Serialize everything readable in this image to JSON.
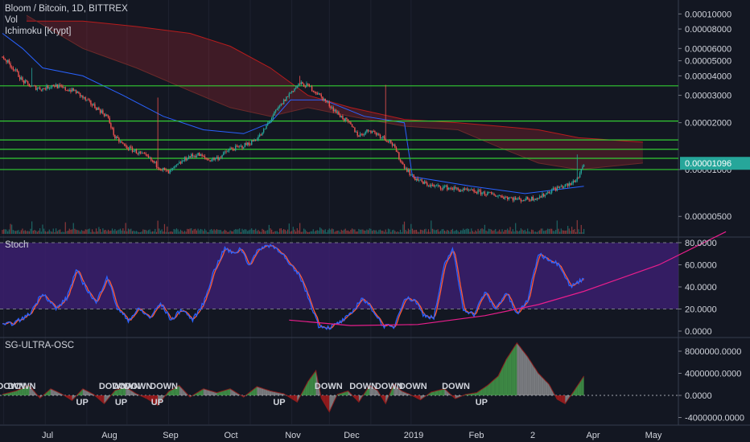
{
  "header": {
    "symbol_line": "Bloom / Bitcoin, 1D, BITTREX",
    "indicator_vol": "Vol",
    "indicator_ichimoku": "Ichimoku [Krypt]"
  },
  "price_badge": "0.00001096",
  "panes": {
    "stoch_label": "Stoch",
    "osc_label": "SG-ULTRA-OSC"
  },
  "colors": {
    "background": "#131722",
    "bull": "#26a69a",
    "bear": "#ef5350",
    "hline": "#33cc33",
    "stoch_fill": "#3b1f6e",
    "stoch_k": "#2962ff",
    "stoch_d": "#ff5a36",
    "curve": "#e91e8c",
    "badge": "#26a69a"
  },
  "chart_data": [
    {
      "type": "candlestick",
      "title": "Bloom / Bitcoin, 1D, BITTREX",
      "x_tick_labels": [
        "Jul",
        "Aug",
        "Sep",
        "Oct",
        "Nov",
        "Dec",
        "2019",
        "Feb",
        "2",
        "Apr",
        "May"
      ],
      "y_tick_labels": [
        "0.00010000",
        "0.00008000",
        "0.00006000",
        "0.00005000",
        "0.00004000",
        "0.00003000",
        "0.00002000",
        "0.00001000",
        "0.00000500"
      ],
      "y_scale": "log",
      "last_price": 1.096e-05,
      "close_trend": [
        [
          0,
          5.3e-05
        ],
        [
          8,
          4.5e-05
        ],
        [
          15,
          3.7e-05
        ],
        [
          22,
          3.4e-05
        ],
        [
          30,
          3.3e-05
        ],
        [
          38,
          3.5e-05
        ],
        [
          46,
          3.3e-05
        ],
        [
          54,
          3.2e-05
        ],
        [
          62,
          2.8e-05
        ],
        [
          70,
          2.5e-05
        ],
        [
          78,
          2.2e-05
        ],
        [
          84,
          1.6e-05
        ],
        [
          92,
          1.4e-05
        ],
        [
          100,
          1.3e-05
        ],
        [
          108,
          1.2e-05
        ],
        [
          116,
          1.05e-05
        ],
        [
          124,
          9.5e-06
        ],
        [
          130,
          1.05e-05
        ],
        [
          138,
          1.2e-05
        ],
        [
          146,
          1.25e-05
        ],
        [
          154,
          1.15e-05
        ],
        [
          162,
          1.2e-05
        ],
        [
          170,
          1.35e-05
        ],
        [
          178,
          1.4e-05
        ],
        [
          186,
          1.5e-05
        ],
        [
          194,
          1.7e-05
        ],
        [
          200,
          2.1e-05
        ],
        [
          208,
          2.6e-05
        ],
        [
          216,
          3.2e-05
        ],
        [
          222,
          3.55e-05
        ],
        [
          228,
          3.45e-05
        ],
        [
          234,
          3.15e-05
        ],
        [
          242,
          2.7e-05
        ],
        [
          250,
          2.3e-05
        ],
        [
          258,
          2e-05
        ],
        [
          266,
          1.65e-05
        ],
        [
          274,
          1.8e-05
        ],
        [
          282,
          1.65e-05
        ],
        [
          290,
          1.5e-05
        ],
        [
          298,
          1.1e-05
        ],
        [
          306,
          9e-06
        ],
        [
          314,
          8.2e-06
        ],
        [
          322,
          7.8e-06
        ],
        [
          330,
          7.7e-06
        ],
        [
          338,
          7.5e-06
        ],
        [
          346,
          7.3e-06
        ],
        [
          354,
          7.2e-06
        ],
        [
          362,
          7e-06
        ],
        [
          370,
          6.8e-06
        ],
        [
          378,
          6.6e-06
        ],
        [
          386,
          6.4e-06
        ],
        [
          394,
          6.5e-06
        ],
        [
          402,
          6.7e-06
        ],
        [
          410,
          7.4e-06
        ],
        [
          418,
          7.8e-06
        ],
        [
          424,
          8e-06
        ],
        [
          430,
          9e-06
        ],
        [
          434,
          1.096e-05
        ]
      ],
      "spikes": [
        {
          "x": 22,
          "high": 4.5e-05
        },
        {
          "x": 116,
          "high": 2.9e-05
        },
        {
          "x": 222,
          "high": 4e-05
        },
        {
          "x": 286,
          "high": 3.5e-05
        },
        {
          "x": 429,
          "high": 1.25e-05
        }
      ],
      "horizontal_levels": [
        3.45e-05,
        2.05e-05,
        1.55e-05,
        1.35e-05,
        1.18e-05,
        1e-05
      ]
    },
    {
      "type": "line",
      "title": "Stoch",
      "y_tick_labels": [
        "80.0000",
        "60.0000",
        "40.0000",
        "20.0000",
        "0.0000"
      ],
      "ylim": [
        0,
        80
      ],
      "bands": [
        20,
        80
      ],
      "k_trend": [
        [
          0,
          5
        ],
        [
          10,
          8
        ],
        [
          20,
          15
        ],
        [
          30,
          35
        ],
        [
          40,
          20
        ],
        [
          48,
          30
        ],
        [
          55,
          55
        ],
        [
          62,
          40
        ],
        [
          70,
          25
        ],
        [
          78,
          50
        ],
        [
          86,
          20
        ],
        [
          94,
          10
        ],
        [
          102,
          20
        ],
        [
          110,
          12
        ],
        [
          118,
          25
        ],
        [
          126,
          10
        ],
        [
          134,
          20
        ],
        [
          142,
          10
        ],
        [
          150,
          25
        ],
        [
          158,
          55
        ],
        [
          166,
          75
        ],
        [
          172,
          70
        ],
        [
          178,
          75
        ],
        [
          184,
          60
        ],
        [
          192,
          75
        ],
        [
          200,
          78
        ],
        [
          208,
          72
        ],
        [
          214,
          60
        ],
        [
          222,
          50
        ],
        [
          230,
          25
        ],
        [
          236,
          5
        ],
        [
          244,
          3
        ],
        [
          252,
          8
        ],
        [
          260,
          15
        ],
        [
          268,
          30
        ],
        [
          276,
          20
        ],
        [
          284,
          5
        ],
        [
          292,
          3
        ],
        [
          300,
          30
        ],
        [
          308,
          28
        ],
        [
          314,
          15
        ],
        [
          322,
          12
        ],
        [
          330,
          60
        ],
        [
          336,
          75
        ],
        [
          344,
          20
        ],
        [
          352,
          15
        ],
        [
          360,
          35
        ],
        [
          368,
          20
        ],
        [
          376,
          35
        ],
        [
          384,
          15
        ],
        [
          392,
          28
        ],
        [
          400,
          70
        ],
        [
          408,
          65
        ],
        [
          416,
          60
        ],
        [
          424,
          40
        ],
        [
          434,
          48
        ]
      ],
      "curve": [
        [
          214,
          10
        ],
        [
          260,
          5
        ],
        [
          310,
          6
        ],
        [
          360,
          14
        ],
        [
          400,
          24
        ],
        [
          434,
          36
        ],
        [
          490,
          60
        ],
        [
          540,
          90
        ]
      ]
    },
    {
      "type": "area",
      "title": "SG-ULTRA-OSC",
      "y_tick_labels": [
        "8000000.0000",
        "4000000.0000",
        "0.0000",
        "-4000000.0000"
      ],
      "ylim": [
        -4000000,
        10000000
      ],
      "osc_trend": [
        [
          0,
          200000
        ],
        [
          10,
          800000
        ],
        [
          20,
          1800000
        ],
        [
          28,
          -500000
        ],
        [
          36,
          1200000
        ],
        [
          44,
          300000
        ],
        [
          52,
          -900000
        ],
        [
          60,
          1200000
        ],
        [
          68,
          200000
        ],
        [
          76,
          -1500000
        ],
        [
          84,
          900000
        ],
        [
          92,
          1500000
        ],
        [
          100,
          300000
        ],
        [
          108,
          -600000
        ],
        [
          116,
          -1800000
        ],
        [
          124,
          700000
        ],
        [
          132,
          1800000
        ],
        [
          140,
          -300000
        ],
        [
          150,
          1200000
        ],
        [
          160,
          500000
        ],
        [
          170,
          1200000
        ],
        [
          180,
          -300000
        ],
        [
          190,
          1600000
        ],
        [
          200,
          800000
        ],
        [
          210,
          300000
        ],
        [
          220,
          -1200000
        ],
        [
          228,
          2500000
        ],
        [
          234,
          4500000
        ],
        [
          238,
          -500000
        ],
        [
          244,
          -3000000
        ],
        [
          250,
          200000
        ],
        [
          258,
          800000
        ],
        [
          266,
          -1200000
        ],
        [
          274,
          1800000
        ],
        [
          280,
          900000
        ],
        [
          286,
          -1500000
        ],
        [
          292,
          2000000
        ],
        [
          298,
          800000
        ],
        [
          304,
          200000
        ],
        [
          312,
          -800000
        ],
        [
          320,
          600000
        ],
        [
          330,
          1200000
        ],
        [
          338,
          -600000
        ],
        [
          346,
          200000
        ],
        [
          354,
          500000
        ],
        [
          362,
          1800000
        ],
        [
          370,
          3500000
        ],
        [
          376,
          6500000
        ],
        [
          384,
          9500000
        ],
        [
          392,
          7000000
        ],
        [
          400,
          4000000
        ],
        [
          408,
          2000000
        ],
        [
          414,
          -700000
        ],
        [
          420,
          -1500000
        ],
        [
          426,
          600000
        ],
        [
          434,
          3500000
        ]
      ],
      "signals": [
        {
          "label": "DOWN",
          "x": 5,
          "pos": "top"
        },
        {
          "label": "DOWN",
          "x": 13,
          "pos": "top"
        },
        {
          "label": "UP",
          "x": 64,
          "pos": "bottom"
        },
        {
          "label": "DOWN",
          "x": 81,
          "pos": "top"
        },
        {
          "label": "DOWN",
          "x": 91,
          "pos": "top"
        },
        {
          "label": "DOWN",
          "x": 100,
          "pos": "top"
        },
        {
          "label": "UP",
          "x": 93,
          "pos": "bottom"
        },
        {
          "label": "DOWN",
          "x": 119,
          "pos": "top"
        },
        {
          "label": "UP",
          "x": 120,
          "pos": "bottom"
        },
        {
          "label": "UP",
          "x": 211,
          "pos": "bottom"
        },
        {
          "label": "DOWN",
          "x": 242,
          "pos": "top"
        },
        {
          "label": "DOWN",
          "x": 268,
          "pos": "top"
        },
        {
          "label": "DOWN",
          "x": 287,
          "pos": "top"
        },
        {
          "label": "DOWN",
          "x": 305,
          "pos": "top"
        },
        {
          "label": "DOWN",
          "x": 337,
          "pos": "top"
        },
        {
          "label": "UP",
          "x": 362,
          "pos": "bottom"
        }
      ]
    }
  ]
}
